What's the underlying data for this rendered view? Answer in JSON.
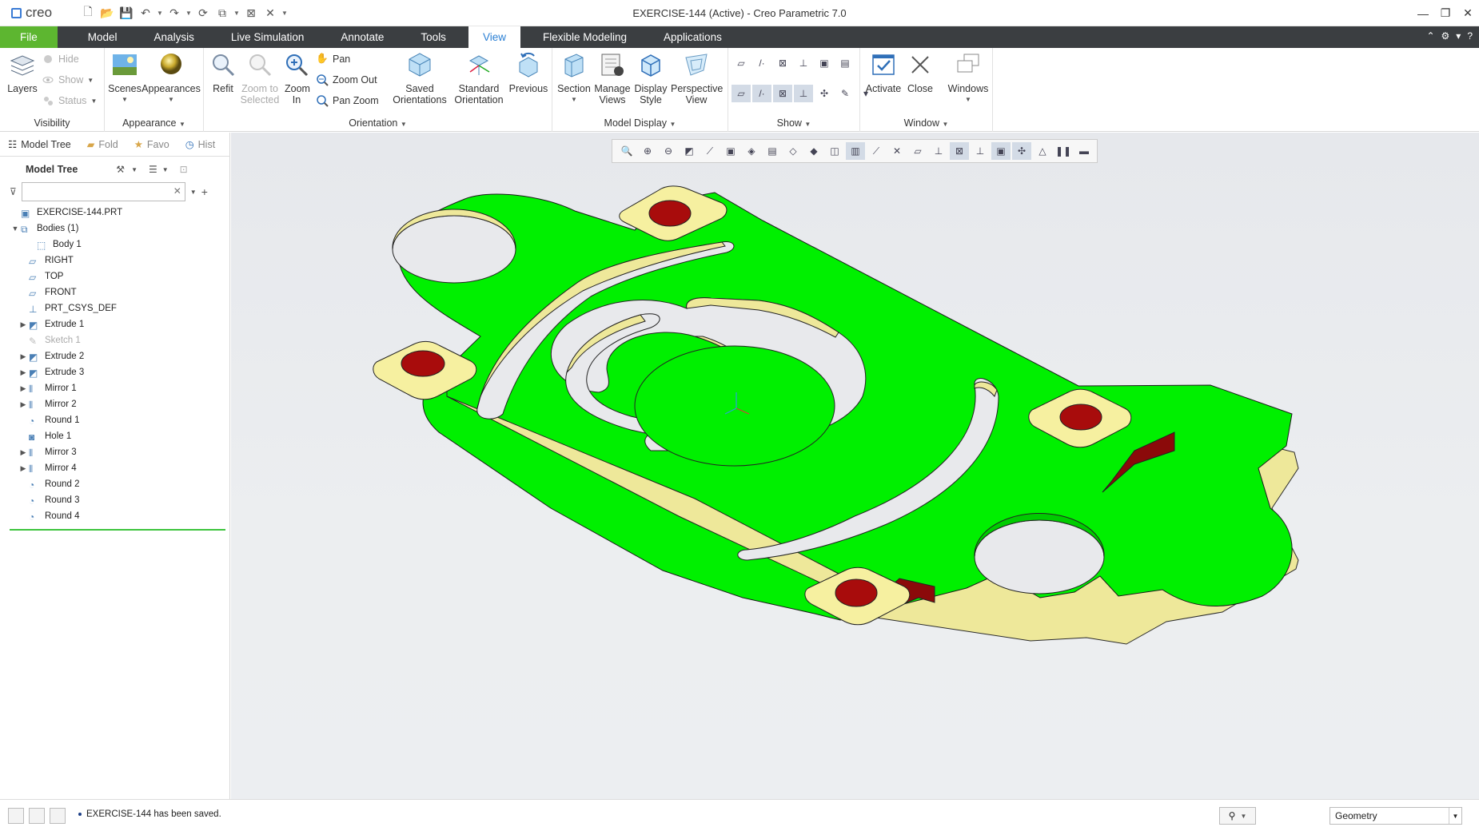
{
  "app": {
    "logo_text": "creo",
    "window_title": "EXERCISE-144 (Active) - Creo Parametric 7.0"
  },
  "tabs": [
    "File",
    "Model",
    "Analysis",
    "Live Simulation",
    "Annotate",
    "Tools",
    "View",
    "Flexible Modeling",
    "Applications"
  ],
  "active_tab": "View",
  "ribbon": {
    "visibility": {
      "label": "Visibility",
      "layers": "Layers",
      "hide": "Hide",
      "show": "Show",
      "status": "Status"
    },
    "appearance": {
      "label": "Appearance",
      "scenes": "Scenes",
      "appearances": "Appearances"
    },
    "orientation": {
      "label": "Orientation",
      "refit": "Refit",
      "zoom_to_selected": "Zoom to Selected",
      "zoom_in": "Zoom In",
      "pan": "Pan",
      "zoom_out": "Zoom Out",
      "pan_zoom": "Pan Zoom",
      "saved_orientations": "Saved Orientations",
      "standard_orientation": "Standard Orientation",
      "previous": "Previous"
    },
    "model_display": {
      "label": "Model Display",
      "section": "Section",
      "manage_views": "Manage Views",
      "display_style": "Display Style",
      "perspective_view": "Perspective View"
    },
    "show": {
      "label": "Show"
    },
    "window": {
      "label": "Window",
      "activate": "Activate",
      "close": "Close",
      "windows": "Windows"
    }
  },
  "panel": {
    "tabs": [
      "Model Tree",
      "Fold",
      "Favo",
      "Hist"
    ],
    "tree_title": "Model Tree",
    "filter_placeholder": "",
    "items": [
      {
        "label": "EXERCISE-144.PRT",
        "indent": 0,
        "expander": "",
        "icon": "part-icon",
        "dim": false
      },
      {
        "label": "Bodies (1)",
        "indent": 0,
        "expander": "▼",
        "icon": "bodies-icon",
        "dim": false
      },
      {
        "label": "Body 1",
        "indent": 2,
        "expander": "",
        "icon": "body-icon",
        "dim": false
      },
      {
        "label": "RIGHT",
        "indent": 1,
        "expander": "",
        "icon": "datum-plane-icon",
        "dim": false
      },
      {
        "label": "TOP",
        "indent": 1,
        "expander": "",
        "icon": "datum-plane-icon",
        "dim": false
      },
      {
        "label": "FRONT",
        "indent": 1,
        "expander": "",
        "icon": "datum-plane-icon",
        "dim": false
      },
      {
        "label": "PRT_CSYS_DEF",
        "indent": 1,
        "expander": "",
        "icon": "csys-icon",
        "dim": false
      },
      {
        "label": "Extrude 1",
        "indent": 1,
        "expander": "▶",
        "icon": "extrude-icon",
        "dim": false
      },
      {
        "label": "Sketch 1",
        "indent": 1,
        "expander": "",
        "icon": "sketch-icon",
        "dim": true
      },
      {
        "label": "Extrude 2",
        "indent": 1,
        "expander": "▶",
        "icon": "extrude-icon",
        "dim": false
      },
      {
        "label": "Extrude 3",
        "indent": 1,
        "expander": "▶",
        "icon": "extrude-icon",
        "dim": false
      },
      {
        "label": "Mirror 1",
        "indent": 1,
        "expander": "▶",
        "icon": "mirror-icon",
        "dim": false
      },
      {
        "label": "Mirror 2",
        "indent": 1,
        "expander": "▶",
        "icon": "mirror-icon",
        "dim": false
      },
      {
        "label": "Round 1",
        "indent": 1,
        "expander": "",
        "icon": "round-icon",
        "dim": false
      },
      {
        "label": "Hole 1",
        "indent": 1,
        "expander": "",
        "icon": "hole-icon",
        "dim": false
      },
      {
        "label": "Mirror 3",
        "indent": 1,
        "expander": "▶",
        "icon": "mirror-icon",
        "dim": false
      },
      {
        "label": "Mirror 4",
        "indent": 1,
        "expander": "▶",
        "icon": "mirror-icon",
        "dim": false
      },
      {
        "label": "Round 2",
        "indent": 1,
        "expander": "",
        "icon": "round-icon",
        "dim": false
      },
      {
        "label": "Round 3",
        "indent": 1,
        "expander": "",
        "icon": "round-icon",
        "dim": false
      },
      {
        "label": "Round 4",
        "indent": 1,
        "expander": "",
        "icon": "round-icon",
        "dim": false
      }
    ]
  },
  "status": {
    "message": "EXERCISE-144 has been saved.",
    "filter_value": "Geometry"
  },
  "colors": {
    "file_tab": "#5db630",
    "tab_bar": "#3b3e41",
    "active_tab_text": "#2a7fd4",
    "model_face": "#00f000",
    "model_side": "#eee89a",
    "hole": "#a10c0c"
  }
}
